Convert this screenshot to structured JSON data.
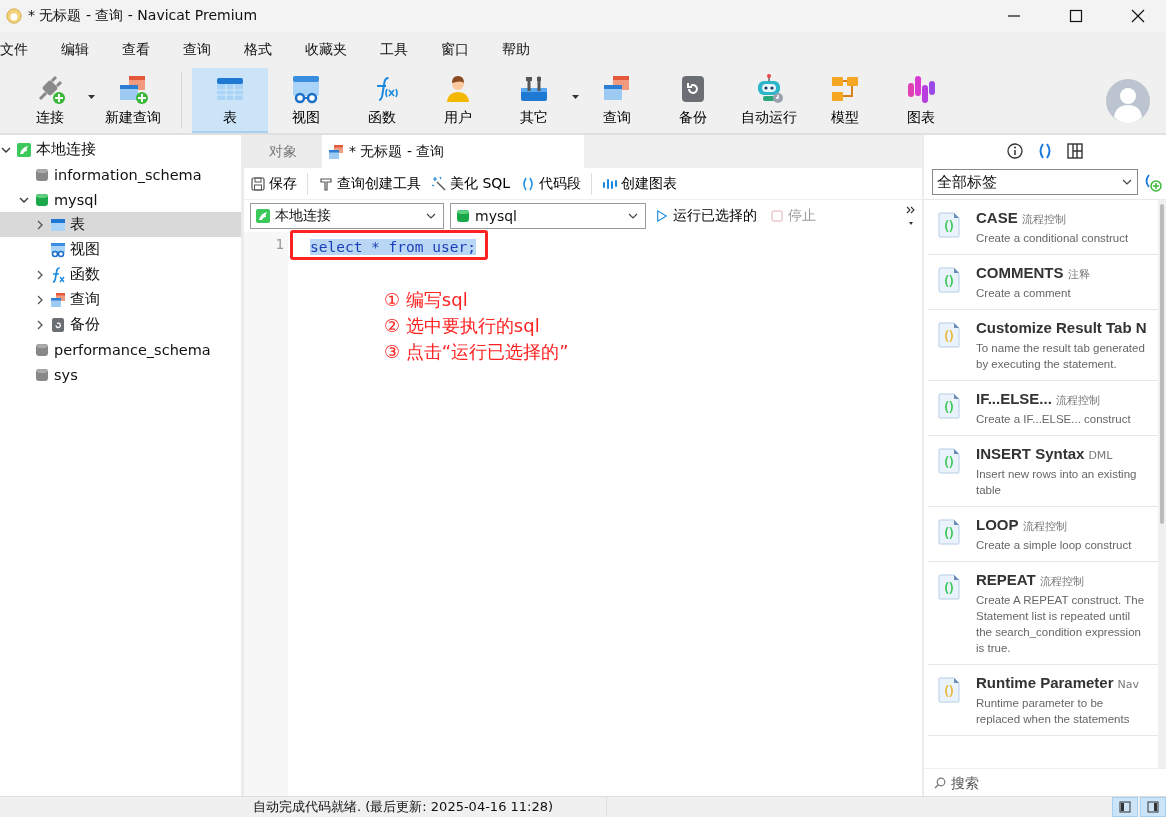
{
  "window": {
    "title": "* 无标题 - 查询 - Navicat Premium"
  },
  "menu": [
    "文件",
    "编辑",
    "查看",
    "查询",
    "格式",
    "收藏夹",
    "工具",
    "窗口",
    "帮助"
  ],
  "toolbar": [
    {
      "label": "连接",
      "selected": false,
      "dropdown": true
    },
    {
      "label": "新建查询",
      "selected": false
    },
    {
      "label": "表",
      "selected": true
    },
    {
      "label": "视图",
      "selected": false
    },
    {
      "label": "函数",
      "selected": false
    },
    {
      "label": "用户",
      "selected": false
    },
    {
      "label": "其它",
      "selected": false,
      "dropdown": true
    },
    {
      "label": "查询",
      "selected": false
    },
    {
      "label": "备份",
      "selected": false
    },
    {
      "label": "自动运行",
      "selected": false
    },
    {
      "label": "模型",
      "selected": false
    },
    {
      "label": "图表",
      "selected": false
    }
  ],
  "sidebar": {
    "items": [
      {
        "label": "本地连接",
        "kind": "connection",
        "expanded": true,
        "selected": false,
        "children": [
          {
            "label": "information_schema",
            "kind": "database",
            "selected": false
          },
          {
            "label": "mysql",
            "kind": "database",
            "expanded": true,
            "selected": false,
            "children": [
              {
                "label": "表",
                "kind": "table",
                "expanded": false,
                "selected": true
              },
              {
                "label": "视图",
                "kind": "view",
                "selected": false
              },
              {
                "label": "函数",
                "kind": "function",
                "expanded": false,
                "selected": false
              },
              {
                "label": "查询",
                "kind": "query",
                "expanded": false,
                "selected": false
              },
              {
                "label": "备份",
                "kind": "backup",
                "expanded": false,
                "selected": false
              }
            ]
          },
          {
            "label": "performance_schema",
            "kind": "database",
            "selected": false
          },
          {
            "label": "sys",
            "kind": "database",
            "selected": false
          }
        ]
      }
    ]
  },
  "editor": {
    "tabs": [
      {
        "label": "对象",
        "selected": false
      },
      {
        "label": "* 无标题 - 查询",
        "selected": true
      }
    ],
    "tools": [
      "保存",
      "查询创建工具",
      "美化 SQL",
      "代码段",
      "创建图表"
    ],
    "connection": "本地连接",
    "database": "mysql",
    "run": "运行已选择的",
    "stop": {
      "label": "停止",
      "disabled": true
    },
    "lines": [
      {
        "number": "1",
        "code": "select * from user;",
        "selected": true
      }
    ],
    "annotations": [
      "① 编写sql",
      "② 选中要执行的sql",
      "③ 点击“运行已选择的”"
    ]
  },
  "snippets": {
    "filter": "全部标签",
    "items": [
      {
        "title": "CASE",
        "tag": "流程控制",
        "description": "Create a conditional construct",
        "color": "#3cc85a"
      },
      {
        "title": "COMMENTS",
        "tag": "注释",
        "description": "Create a comment",
        "color": "#3cc85a"
      },
      {
        "title": "Customize Result Tab N",
        "description": "To name the result tab generated by executing the statement.",
        "color": "#e8b83a"
      },
      {
        "title": "IF...ELSE...",
        "tag": "流程控制",
        "description": "Create a IF...ELSE... construct",
        "color": "#3cc85a"
      },
      {
        "title": "INSERT Syntax",
        "tag": "DML",
        "description": "Insert new rows into an existing table",
        "color": "#3cc85a"
      },
      {
        "title": "LOOP",
        "tag": "流程控制",
        "description": "Create a simple loop construct",
        "color": "#3cc85a"
      },
      {
        "title": "REPEAT",
        "tag": "流程控制",
        "description": "Create A REPEAT construct. The Statement list is repeated until the search_condition expression is true.",
        "color": "#3cc85a"
      },
      {
        "title": "Runtime Parameter",
        "tag": "Nav",
        "description": "Runtime parameter to be replaced when the statements",
        "color": "#e8b83a"
      }
    ],
    "search": {
      "placeholder": "搜索"
    }
  },
  "status_bar": "自动完成代码就绪. (最后更新: 2025-04-16 11:28)"
}
